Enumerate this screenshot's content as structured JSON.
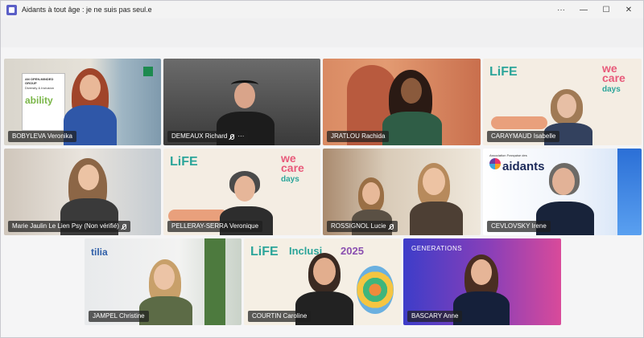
{
  "window": {
    "title": "Aidants à tout âge : je ne suis pas seul.e",
    "more_label": "···",
    "minimize_label": "—",
    "maximize_label": "☐",
    "close_label": "✕"
  },
  "participants": [
    {
      "name": "BOBYLEVA Veronika",
      "muted": false
    },
    {
      "name": "DEMEAUX Richard",
      "muted": true,
      "more": "···"
    },
    {
      "name": "JRATLOU Rachida",
      "muted": false
    },
    {
      "name": "CARAYMAUD Isabelle",
      "muted": false
    },
    {
      "name": "Marie Jaulin Le Lien Psy (Non vérifié)",
      "muted": true
    },
    {
      "name": "PELLERAY-SERRA Veronique",
      "muted": false
    },
    {
      "name": "ROSSIGNOL Lucie",
      "muted": true
    },
    {
      "name": "CEVLOVSKY Irene",
      "muted": false
    },
    {
      "name": "JAMPEL Christine",
      "muted": false
    },
    {
      "name": "COURTIN Caroline",
      "muted": false
    },
    {
      "name": "BASCARY Anne",
      "muted": false
    }
  ],
  "backgrounds": {
    "ability_banner_line1": "AN OPEN-MINDED GROUP",
    "ability_banner_line2": "Diversity & Inclusion",
    "ability_word": "ability",
    "life_logo": "LiFE",
    "wecare_logo": "we care",
    "wecare_days": "days",
    "aidants_small": "Association Française des",
    "aidants_logo": "aidants",
    "tilia_logo": "tilia",
    "inclusion_text": "Inclusi",
    "inclusion_year": "2025",
    "generations_text": "GENERATIONS"
  },
  "colors": {
    "accent": "#5b5fc7",
    "nametag_bg": "#1e1e1e",
    "life_teal": "#2ca59a",
    "wecare_pink": "#e85a7a",
    "generations_blue": "#3d3dc9",
    "generations_pink": "#d94a9a"
  }
}
